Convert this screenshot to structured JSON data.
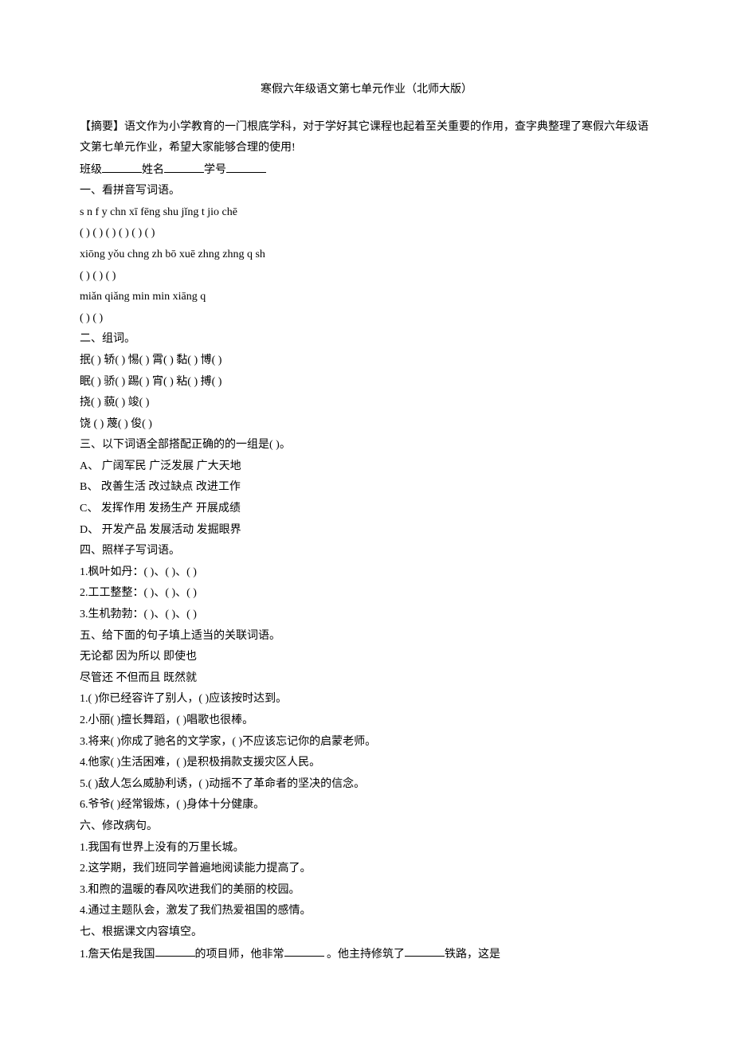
{
  "title": "寒假六年级语文第七单元作业（北师大版）",
  "abstract": "【摘要】语文作为小学教育的一门根底学科，对于学好其它课程也起着至关重要的作用，查字典整理了寒假六年级语文第七单元作业，希望大家能够合理的使用!",
  "name_line": {
    "class_label": "班级",
    "name_label": "姓名",
    "id_label": "学号"
  },
  "q1": {
    "header": "一、看拼音写词语。",
    "line1": "s n f y chn xī fēng shu jǐng t jio chē",
    "paren1": "( ) ( ) ( ) ( ) ( ) ( )",
    "line2": "xiōng yǒu chng zh bō xuē zhng zhng q sh",
    "paren2": "( ) ( ) ( )",
    "line3": "miǎn qiǎng min min xiāng q",
    "paren3": "( ) ( )"
  },
  "q2": {
    "header": "二、组词。",
    "line1": "抿( )  轿( )  惕( )  霄( )  黏( )  博( )",
    "line2": "眠( )  骄( )  踢( )  宵( )  粘( )  搏( )",
    "line3": "挠( )  藐( )  竣( )",
    "line4": "饶 ( )  蔑( )  俊( )"
  },
  "q3": {
    "header": "三、以下词语全部搭配正确的的一组是( )。",
    "opts": [
      "A、  广阔军民  广泛发展  广大天地",
      "B、  改善生活  改过缺点  改进工作",
      "C、  发挥作用  发扬生产  开展成绩",
      "D、  开发产品  发展活动  发掘眼界"
    ]
  },
  "q4": {
    "header": "四、照样子写词语。",
    "items": [
      "1.枫叶如丹：( )、( )、( )",
      "2.工工整整：( )、( )、( )",
      "3.生机勃勃：( )、( )、( )"
    ]
  },
  "q5": {
    "header": "五、给下面的句子填上适当的关联词语。",
    "pre1": "无论都  因为所以  即使也",
    "pre2": "尽管还  不但而且  既然就",
    "items": [
      "1.( )你已经容许了别人，( )应该按时达到。",
      "2.小丽( )擅长舞蹈，( )唱歌也很棒。",
      "3.将来( )你成了驰名的文学家，( )不应该忘记你的启蒙老师。",
      "4.他家( )生活困难，( )是积极捐款支援灾区人民。",
      "5.( )敌人怎么威胁利诱，( )动摇不了革命者的坚决的信念。",
      "6.爷爷( )经常锻炼，( )身体十分健康。"
    ]
  },
  "q6": {
    "header": "六、修改病句。",
    "items": [
      "1.我国有世界上没有的万里长城。",
      "2.这学期，我们班同学普遍地阅读能力提高了。",
      "3.和煦的温暖的春风吹进我们的美丽的校园。",
      "4.通过主题队会，激发了我们热爱祖国的感情。"
    ]
  },
  "q7": {
    "header": "七、根据课文内容填空。",
    "item1_p1": "1.詹天佑是我国",
    "item1_p2": "的项目师，他非常",
    "item1_p3": " 。他主持修筑了",
    "item1_p4": "铁路，这是"
  }
}
